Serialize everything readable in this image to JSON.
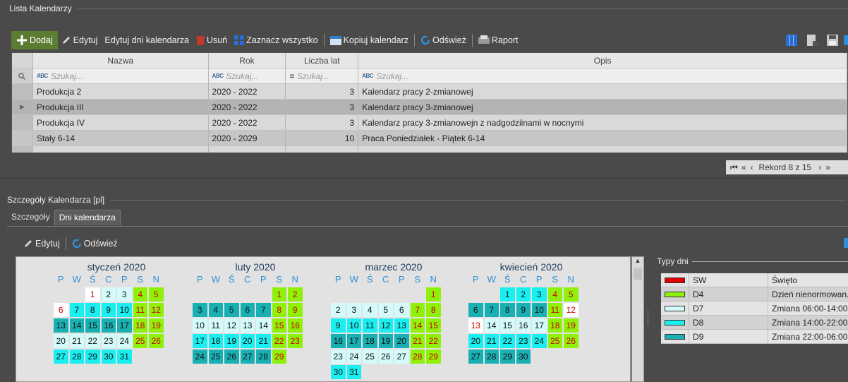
{
  "top_panel": {
    "title": "Lista Kalendarzy"
  },
  "toolbar": {
    "add": "Dodaj",
    "edit": "Edytuj",
    "edit_days": "Edytuj dni kalendarza",
    "delete": "Usuń",
    "select_all": "Zaznacz wszystko",
    "copy": "Kopiuj kalendarz",
    "refresh": "Odśwież",
    "report": "Raport"
  },
  "grid": {
    "columns": [
      "Nazwa",
      "Rok",
      "Liczba lat",
      "Opis"
    ],
    "filter_placeholder": "Szukaj...",
    "rows": [
      {
        "name": "Produkcja 2",
        "year": "2020 - 2022",
        "years": "3",
        "desc": "Kalendarz pracy 2-zmianowej"
      },
      {
        "name": "Produkcja III",
        "year": "2020 - 2022",
        "years": "3",
        "desc": "Kalendarz pracy 3-zmianowej"
      },
      {
        "name": "Produkcja IV",
        "year": "2020 - 2022",
        "years": "3",
        "desc": "Kalendarz pracy 3-zmianowejn z nadgodziinami w nocnymi"
      },
      {
        "name": "Stały 6-14",
        "year": "2020 - 2029",
        "years": "10",
        "desc": "Praca Poniedziałek - Piątek 6-14"
      }
    ],
    "record_nav": "Rekord 8 z 15"
  },
  "details_panel": {
    "title": "Szczegóły Kalendarza [pl]",
    "tabs": [
      "Szczegóły",
      "Dni kalendarza"
    ],
    "edit": "Edytuj",
    "refresh": "Odśwież"
  },
  "calendar": {
    "weekdays": [
      "P",
      "W",
      "Ś",
      "C",
      "P",
      "S",
      "N"
    ],
    "months": [
      {
        "title": "styczeń 2020",
        "offset": 2,
        "types": [
          "w",
          "7",
          "7",
          "4",
          "4",
          "w",
          "8",
          "8",
          "8",
          "8",
          "4",
          "4",
          "9",
          "9",
          "9",
          "9",
          "9",
          "4",
          "4",
          "7",
          "7",
          "7",
          "7",
          "7",
          "4",
          "4",
          "8",
          "8",
          "8",
          "8",
          "8"
        ]
      },
      {
        "title": "luty 2020",
        "offset": 5,
        "types": [
          "4",
          "4",
          "9",
          "9",
          "9",
          "9",
          "9",
          "4",
          "4",
          "7",
          "7",
          "7",
          "7",
          "7",
          "4",
          "4",
          "8",
          "8",
          "8",
          "8",
          "8",
          "4",
          "4",
          "9",
          "9",
          "9",
          "9",
          "9",
          "4"
        ]
      },
      {
        "title": "marzec 2020",
        "offset": 6,
        "types": [
          "4",
          "7",
          "7",
          "7",
          "7",
          "7",
          "4",
          "4",
          "8",
          "8",
          "8",
          "8",
          "8",
          "4",
          "4",
          "9",
          "9",
          "9",
          "9",
          "9",
          "4",
          "4",
          "7",
          "7",
          "7",
          "7",
          "7",
          "4",
          "4",
          "8",
          "8"
        ]
      },
      {
        "title": "kwiecień 2020",
        "offset": 2,
        "types": [
          "8",
          "8",
          "8",
          "4",
          "4",
          "9",
          "9",
          "9",
          "9",
          "9",
          "4",
          "w",
          "w",
          "7",
          "7",
          "7",
          "7",
          "4",
          "4",
          "8",
          "8",
          "8",
          "8",
          "8",
          "4",
          "4",
          "9",
          "9",
          "9",
          "9"
        ]
      }
    ]
  },
  "legend": {
    "title": "Typy dni",
    "items": [
      {
        "code": "SW",
        "label": "Święto",
        "color": "#e00000"
      },
      {
        "code": "D4",
        "label": "Dzień nienormowan...",
        "color": "#8ff00a"
      },
      {
        "code": "D7",
        "label": "Zmiana 06:00-14:00",
        "color": "#d4fbfb"
      },
      {
        "code": "D8",
        "label": "Zmiana 14:00-22:00",
        "color": "#19eef0"
      },
      {
        "code": "D9",
        "label": "Zmiana 22:00-06:00",
        "color": "#19b0b4"
      }
    ]
  }
}
